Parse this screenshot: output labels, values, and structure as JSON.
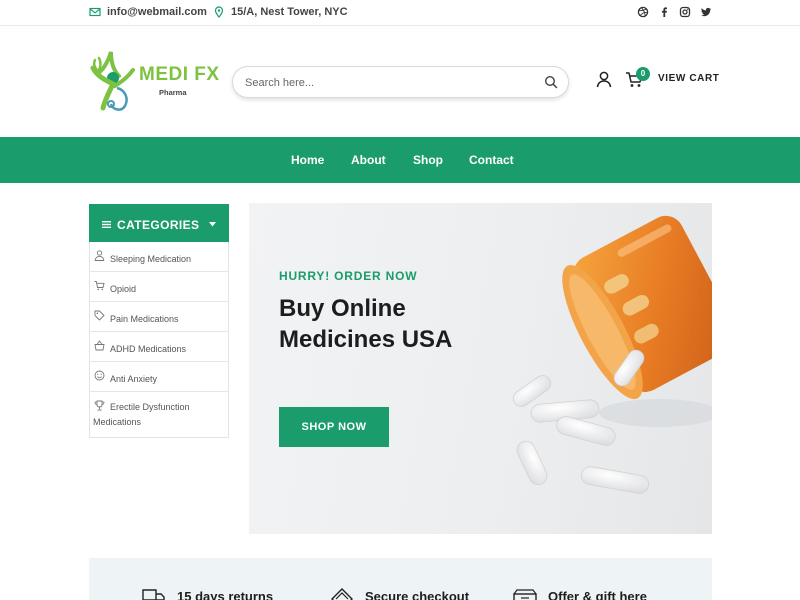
{
  "topbar": {
    "email": "info@webmail.com",
    "address": "15/A, Nest Tower, NYC",
    "social": [
      "dribbble-icon",
      "facebook-icon",
      "instagram-icon",
      "twitter-icon"
    ]
  },
  "header": {
    "brand": "MEDI FX",
    "brand_sub": "Pharma",
    "search_placeholder": "Search here...",
    "cart_count": "0",
    "view_cart": "VIEW CART"
  },
  "nav": {
    "items": [
      "Home",
      "About",
      "Shop",
      "Contact"
    ]
  },
  "categories": {
    "title": "CATEGORIES",
    "items": [
      {
        "label": "Sleeping Medication",
        "icon": "person-icon"
      },
      {
        "label": "Opioid",
        "icon": "cart-icon"
      },
      {
        "label": "Pain Medications",
        "icon": "tag-icon"
      },
      {
        "label": "ADHD Medications",
        "icon": "basket-icon"
      },
      {
        "label": "Anti Anxiety",
        "icon": "smile-icon"
      },
      {
        "label": "Erectile Dysfunction Medications",
        "icon": "trophy-icon"
      }
    ]
  },
  "hero": {
    "tagline": "HURRY! ORDER NOW",
    "headline": "Buy Online Medicines USA",
    "button": "SHOP NOW"
  },
  "features": [
    {
      "label": "15 days returns",
      "icon": "truck-icon"
    },
    {
      "label": "Secure checkout",
      "icon": "card-icon"
    },
    {
      "label": "Offer & gift here",
      "icon": "gift-icon"
    }
  ],
  "colors": {
    "accent": "#1a9c6c",
    "brand_green": "#7dc242",
    "feature_bg": "#eef3f5"
  }
}
